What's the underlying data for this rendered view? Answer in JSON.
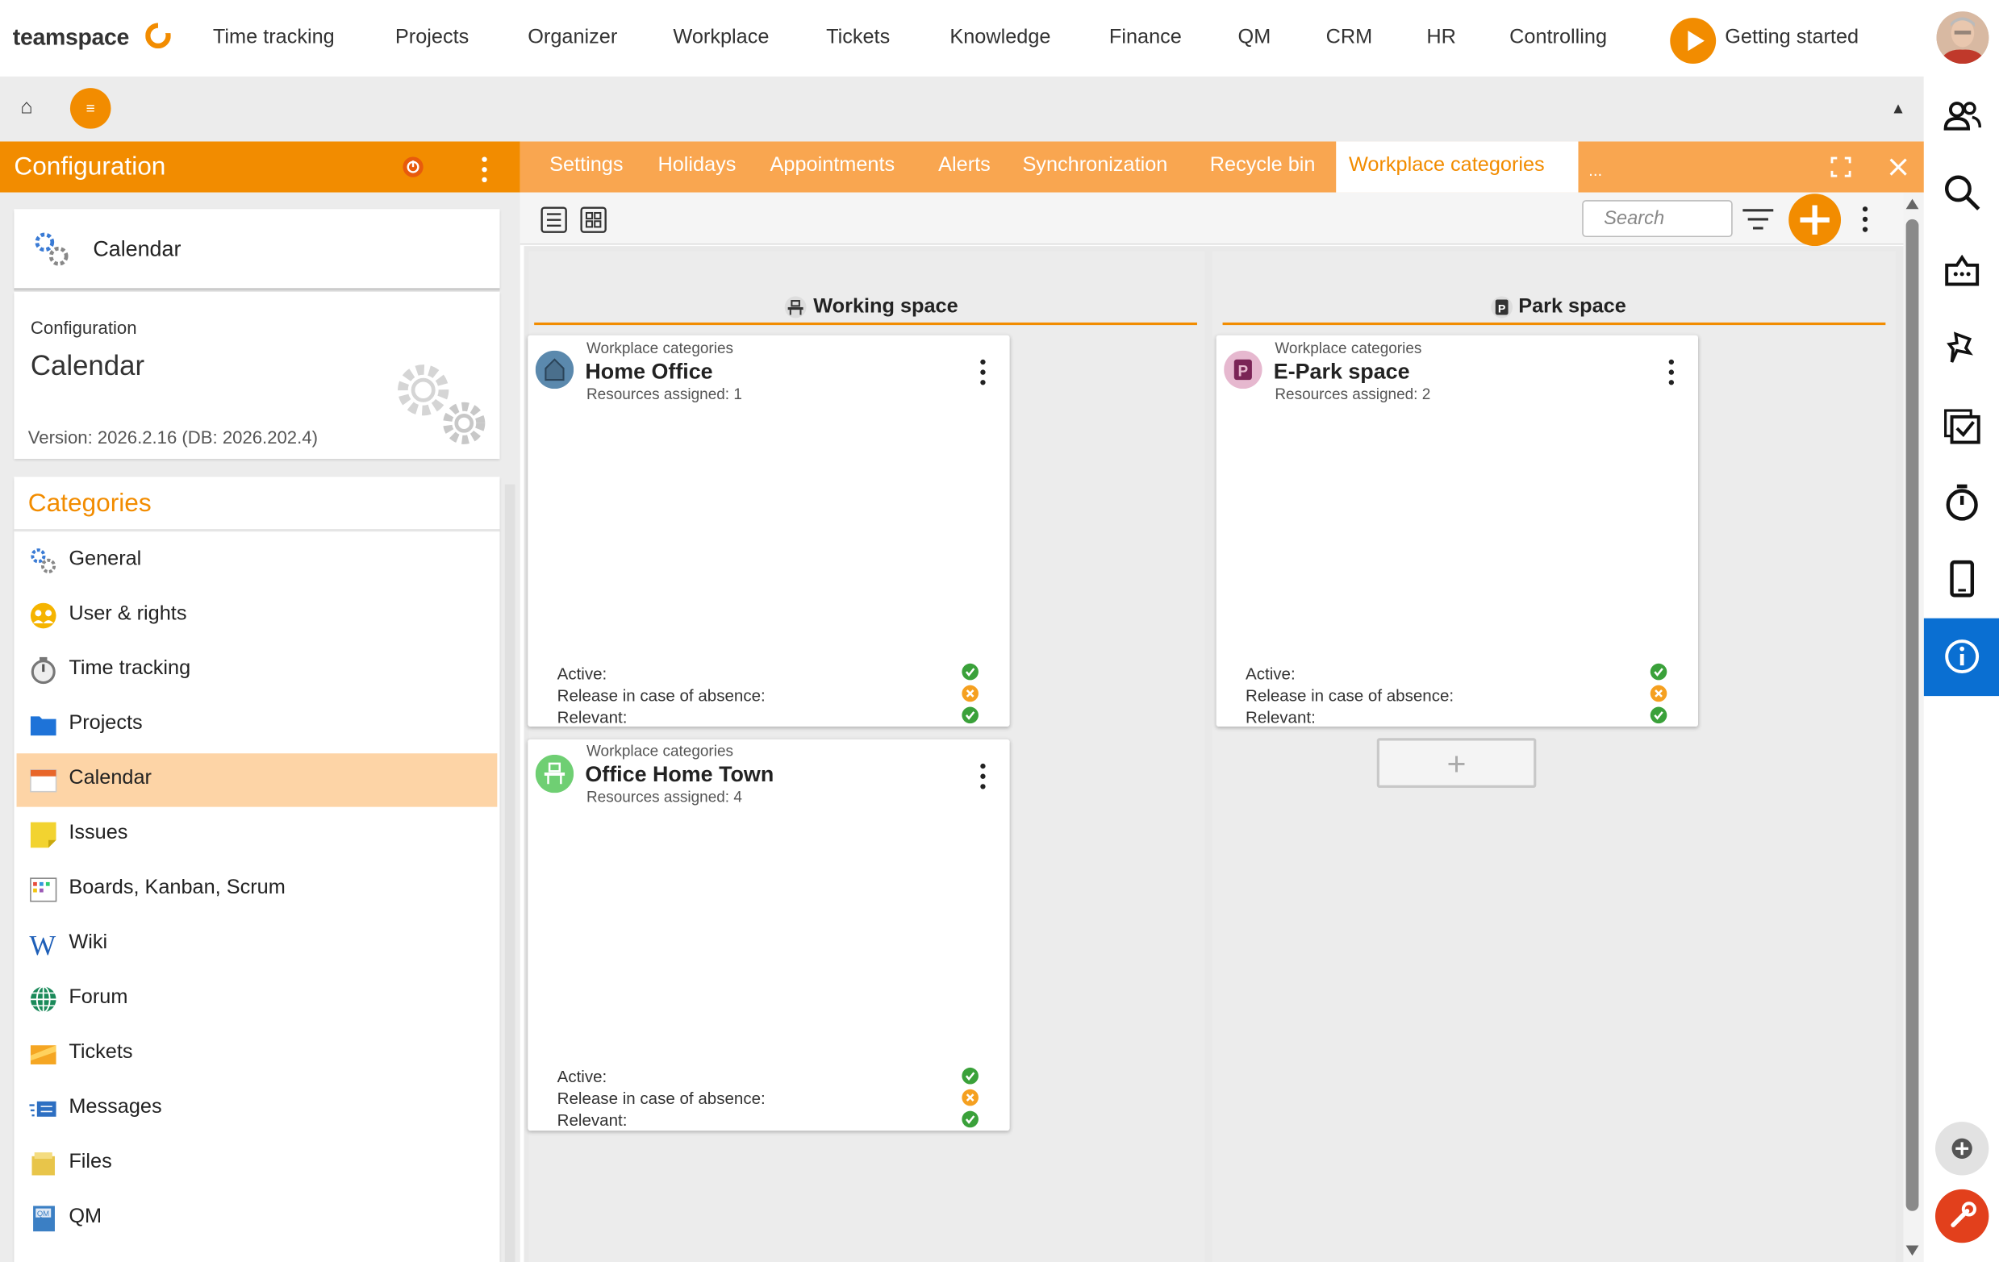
{
  "app": {
    "logo_text": "teamspace"
  },
  "nav": {
    "items": [
      "Time tracking",
      "Projects",
      "Organizer",
      "Workplace",
      "Tickets",
      "Knowledge",
      "Finance",
      "QM",
      "CRM",
      "HR",
      "Controlling"
    ],
    "getting_started": "Getting started"
  },
  "config": {
    "header_title": "Configuration",
    "module_name": "Calendar",
    "info_label": "Configuration",
    "info_title": "Calendar",
    "version": "Version: 2026.2.16 (DB: 2026.202.4)",
    "categories_title": "Categories",
    "categories": [
      {
        "label": "General",
        "icon": "gears-icon"
      },
      {
        "label": "User & rights",
        "icon": "users-icon"
      },
      {
        "label": "Time tracking",
        "icon": "stopwatch-icon"
      },
      {
        "label": "Projects",
        "icon": "folder-icon"
      },
      {
        "label": "Calendar",
        "icon": "calendar-icon",
        "selected": true
      },
      {
        "label": "Issues",
        "icon": "sticky-note-icon"
      },
      {
        "label": "Boards, Kanban, Scrum",
        "icon": "board-icon"
      },
      {
        "label": "Wiki",
        "icon": "wiki-icon"
      },
      {
        "label": "Forum",
        "icon": "globe-icon"
      },
      {
        "label": "Tickets",
        "icon": "ticket-icon"
      },
      {
        "label": "Messages",
        "icon": "messages-icon"
      },
      {
        "label": "Files",
        "icon": "files-icon"
      },
      {
        "label": "QM",
        "icon": "qm-book-icon"
      }
    ]
  },
  "tabs": {
    "items": [
      "Settings",
      "Holidays",
      "Appointments",
      "Alerts",
      "Synchronization",
      "Recycle bin",
      "Workplace categories"
    ],
    "active": "Workplace categories",
    "more": "..."
  },
  "toolbar": {
    "search_placeholder": "Search"
  },
  "board": {
    "columns": [
      {
        "title": "Working space",
        "cards": [
          {
            "category": "Workplace categories",
            "title": "Home Office",
            "resources": "Resources assigned: 1",
            "active_label": "Active:",
            "release_label": "Release in case of absence:",
            "relevant_label": "Relevant:"
          },
          {
            "category": "Workplace categories",
            "title": "Office Home Town",
            "resources": "Resources assigned: 4",
            "active_label": "Active:",
            "release_label": "Release in case of absence:",
            "relevant_label": "Relevant:"
          }
        ]
      },
      {
        "title": "Park space",
        "cards": [
          {
            "category": "Workplace categories",
            "title": "E-Park space",
            "resources": "Resources assigned: 2",
            "active_label": "Active:",
            "release_label": "Release in case of absence:",
            "relevant_label": "Relevant:"
          }
        ]
      }
    ],
    "add_card_symbol": "+"
  },
  "colors": {
    "accent": "#f28c00",
    "tab_bar": "#f9a650",
    "selected_row": "#fdd4a6",
    "info_blue": "#0a6fd2",
    "status_green": "#3aa13a",
    "status_orange": "#f5a020"
  }
}
